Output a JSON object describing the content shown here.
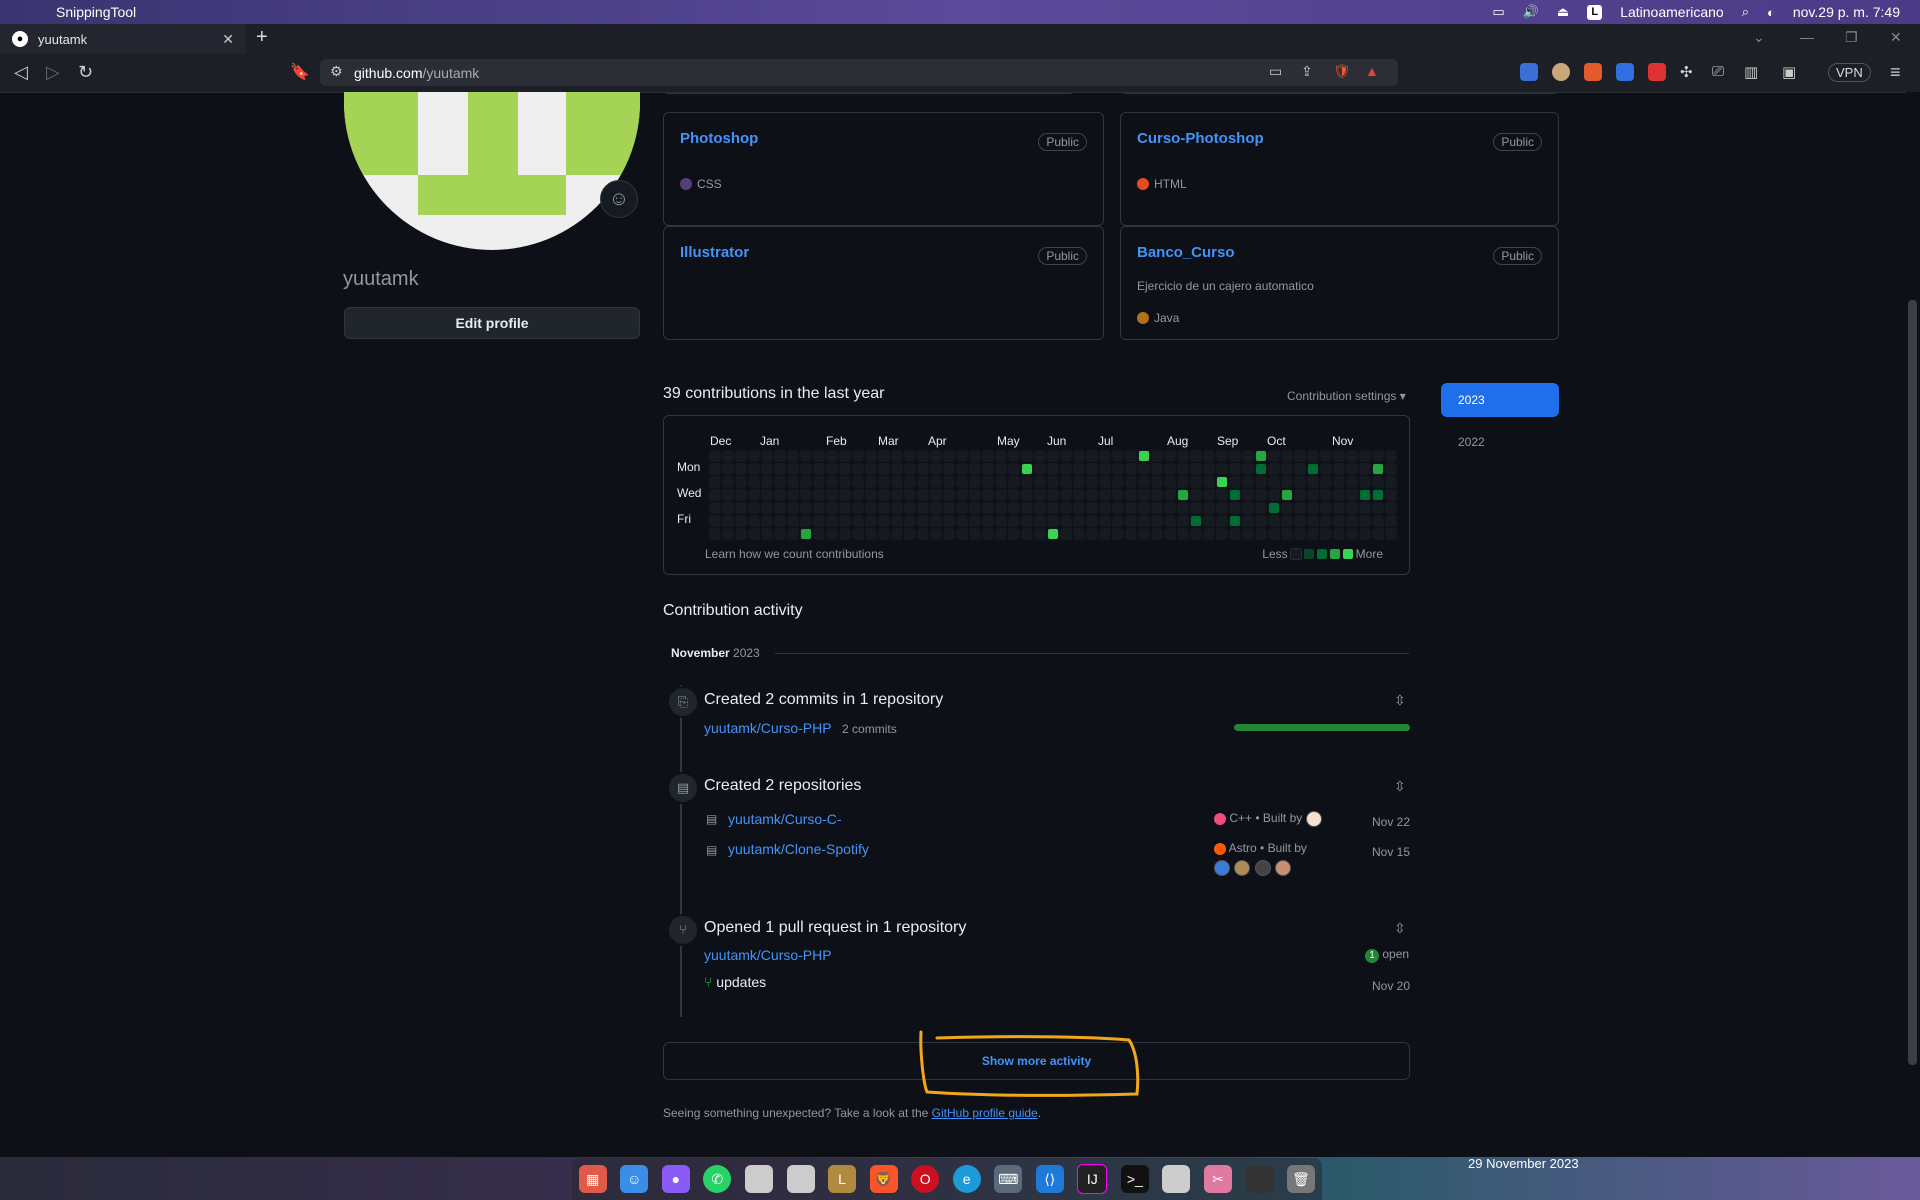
{
  "menubar": {
    "app": "SnippingTool",
    "language": "Latinoamericano",
    "language_badge": "L",
    "clock": "nov.29 p. m. 7:49"
  },
  "tab": {
    "title": "yuutamk"
  },
  "url": {
    "host": "github.com",
    "path": "/yuutamk"
  },
  "vpn": "VPN",
  "profile": {
    "login": "yuutamk",
    "edit_label": "Edit profile"
  },
  "repos": [
    {
      "name": "Photoshop",
      "visibility": "Public",
      "desc": "",
      "language": "CSS",
      "color": "#563d7c"
    },
    {
      "name": "Curso-Photoshop",
      "visibility": "Public",
      "desc": "",
      "language": "HTML",
      "color": "#e34c26"
    },
    {
      "name": "Illustrator",
      "visibility": "Public",
      "desc": "",
      "language": "",
      "color": ""
    },
    {
      "name": "Banco_Curso",
      "visibility": "Public",
      "desc": "Ejercicio de un cajero automatico",
      "language": "Java",
      "color": "#b07219"
    }
  ],
  "contributions": {
    "title": "39 contributions in the last year",
    "settings": "Contribution settings ▾",
    "months": [
      "Dec",
      "Jan",
      "Feb",
      "Mar",
      "Apr",
      "May",
      "Jun",
      "Jul",
      "Aug",
      "Sep",
      "Oct",
      "Nov"
    ],
    "days": [
      "Mon",
      "Wed",
      "Fri"
    ],
    "learn": "Learn how we count contributions",
    "less": "Less",
    "more": "More",
    "years": [
      "2023",
      "2022"
    ]
  },
  "activity": {
    "title": "Contribution activity",
    "month": "November",
    "year": "2023",
    "commits": {
      "title": "Created 2 commits in 1 repository",
      "repo": "yuutamk/Curso-PHP",
      "count": "2 commits"
    },
    "created": {
      "title": "Created 2 repositories",
      "items": [
        {
          "repo": "yuutamk/Curso-C-",
          "lang": "C++",
          "lang_color": "#f34b7d",
          "built": "Built by",
          "date": "Nov 22"
        },
        {
          "repo": "yuutamk/Clone-Spotify",
          "lang": "Astro",
          "lang_color": "#ff5a03",
          "built": "Built by",
          "date": "Nov 15"
        }
      ]
    },
    "pr": {
      "title": "Opened 1 pull request in 1 repository",
      "repo": "yuutamk/Curso-PHP",
      "open_count": "1",
      "open_label": "open",
      "pr_title": "updates",
      "date": "Nov 20"
    },
    "show_more": "Show more activity",
    "footer_text": "Seeing something unexpected? Take a look at the",
    "footer_link": "GitHub profile guide",
    "footer_end": "."
  },
  "dock": {
    "date_label": "29 November 2023"
  },
  "colors": {
    "accent": "#4493f8",
    "green": "#238636",
    "highlight": "#f2a71b"
  }
}
